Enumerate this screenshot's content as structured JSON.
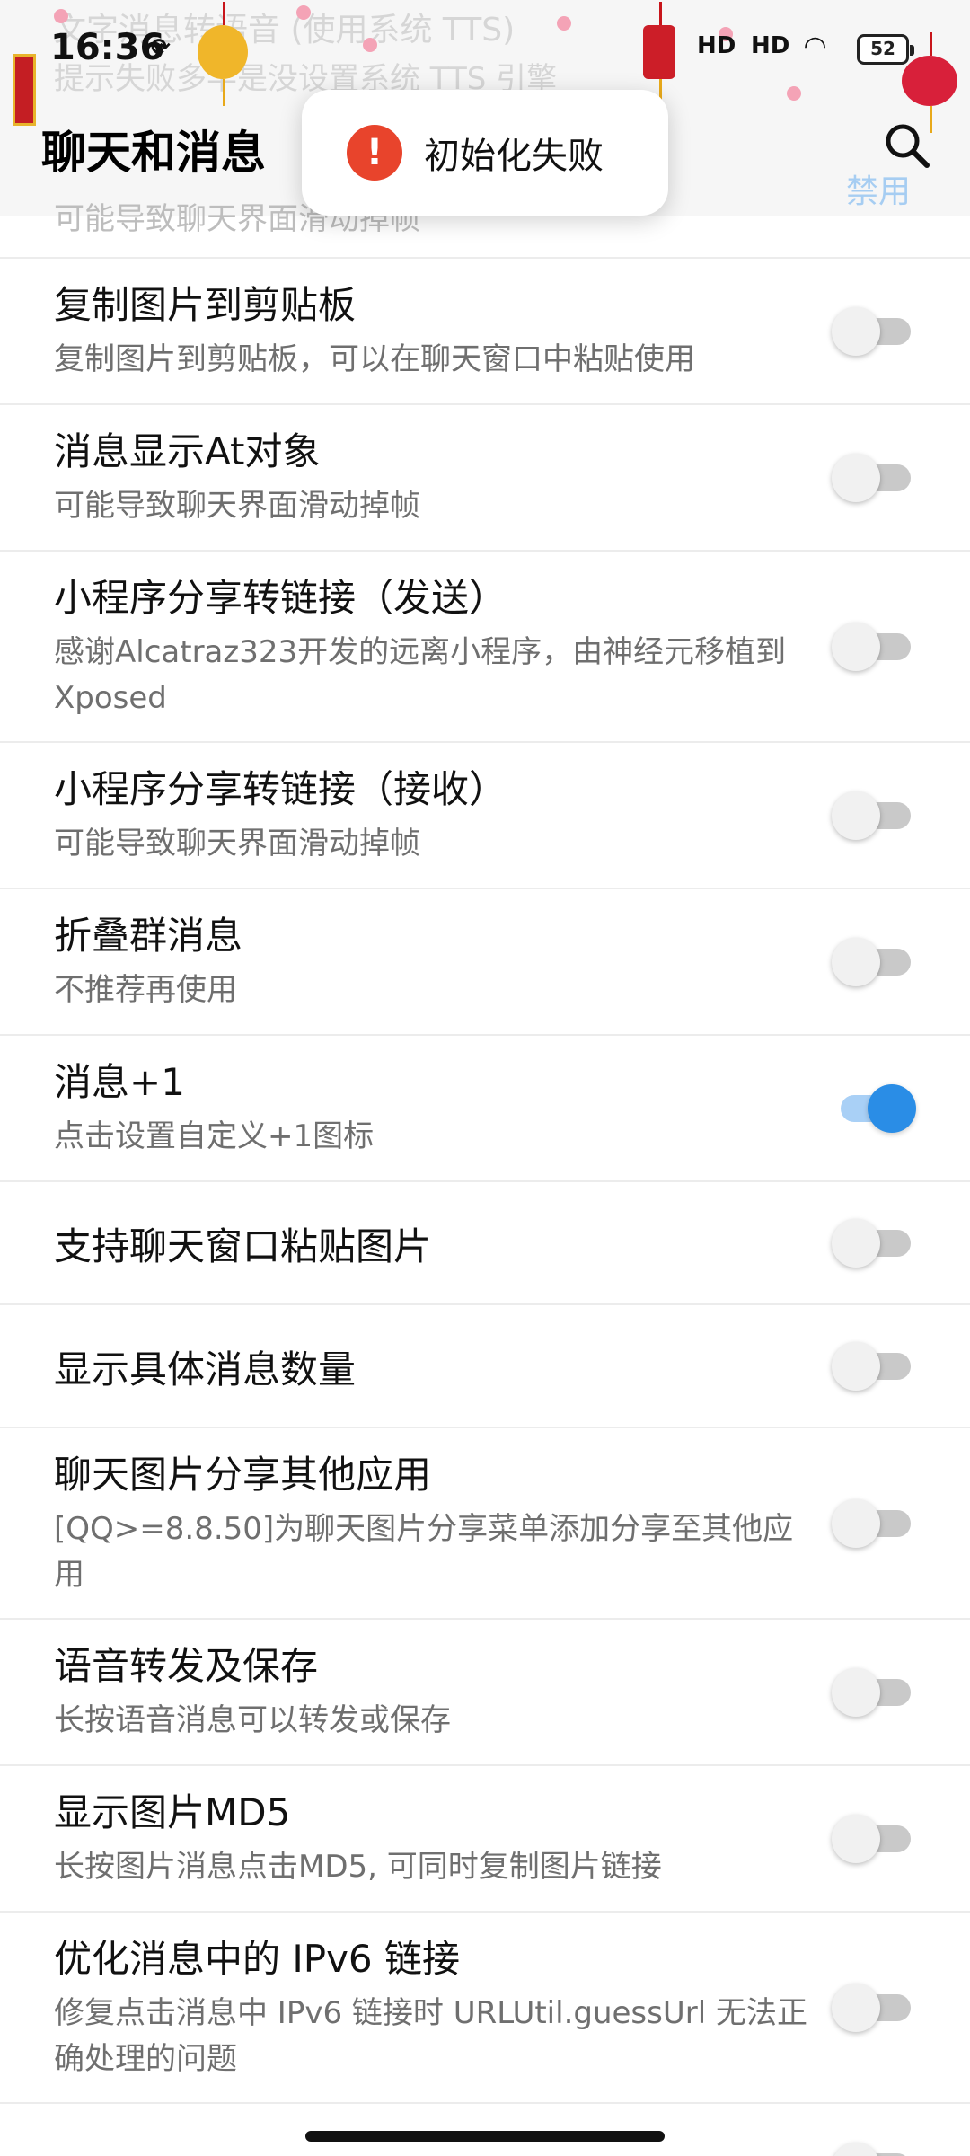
{
  "status": {
    "time": "16:36",
    "battery": "52",
    "signal1": "HD",
    "signal2": "HD"
  },
  "background_ghost": {
    "line1": "文字消息转语音 (使用系统 TTS)",
    "line2": "提示失败多半是没设置系统 TTS 引擎",
    "line3": "可能导致聊天界面滑动掉帧"
  },
  "appbar": {
    "title": "聊天和消息",
    "search_icon": "search-icon",
    "disabled_label": "禁用"
  },
  "toast": {
    "icon": "!",
    "text": "初始化失败"
  },
  "settings": [
    {
      "title": "复制图片到剪贴板",
      "subtitle": "复制图片到剪贴板，可以在聊天窗口中粘贴使用",
      "on": false
    },
    {
      "title": "消息显示At对象",
      "subtitle": "可能导致聊天界面滑动掉帧",
      "on": false
    },
    {
      "title": "小程序分享转链接（发送）",
      "subtitle": "感谢Alcatraz323开发的远离小程序，由神经元移植到Xposed",
      "on": false
    },
    {
      "title": "小程序分享转链接（接收）",
      "subtitle": "可能导致聊天界面滑动掉帧",
      "on": false
    },
    {
      "title": "折叠群消息",
      "subtitle": "不推荐再使用",
      "on": false
    },
    {
      "title": "消息+1",
      "subtitle": "点击设置自定义+1图标",
      "on": true
    },
    {
      "title": "支持聊天窗口粘贴图片",
      "subtitle": "",
      "on": false
    },
    {
      "title": "显示具体消息数量",
      "subtitle": "",
      "on": false
    },
    {
      "title": "聊天图片分享其他应用",
      "subtitle": "[QQ>=8.8.50]为聊天图片分享菜单添加分享至其他应用",
      "on": false
    },
    {
      "title": "语音转发及保存",
      "subtitle": "长按语音消息可以转发或保存",
      "on": false
    },
    {
      "title": "显示图片MD5",
      "subtitle": "长按图片消息点击MD5, 可同时复制图片链接",
      "on": false
    },
    {
      "title": "优化消息中的 IPv6 链接",
      "subtitle": "修复点击消息中 IPv6 链接时 URLUtil.guessUrl 无法正确处理的问题",
      "on": false
    }
  ],
  "colors": {
    "accent": "#2a8de6",
    "toast_icon": "#e8442c"
  }
}
